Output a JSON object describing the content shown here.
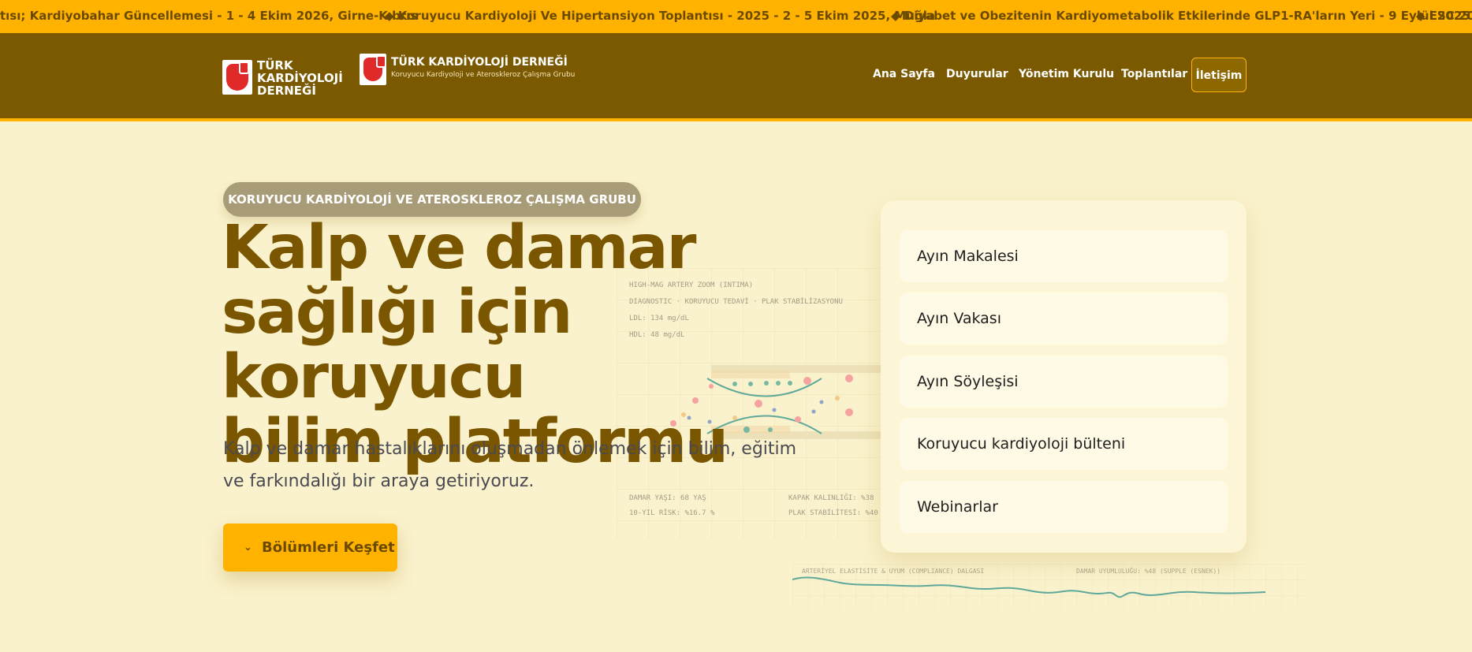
{
  "ticker": {
    "items": [
      "tısı; Kardiyobahar Güncellemesi - 1 - 4 Ekim 2026, Girne-Kıbrıs",
      "◆ Koruyucu Kardiyoloji Ve Hipertansiyon Toplantısı - 2025 - 2 - 5 Ekim 2025, Muğla",
      "◆ Diyabet ve Obezitenin Kardiyometabolik Etkilerinde GLP1-RA'ların Yeri - 9 Eylül 2025",
      "◆ ESC 2025"
    ]
  },
  "header": {
    "logo1": {
      "line1": "TÜRK",
      "line2": "KARDİYOLOJİ",
      "line3": "DERNEĞİ"
    },
    "logo2": {
      "title": "TÜRK KARDİYOLOJİ DERNEĞİ",
      "subtitle": "Koruyucu Kardiyoloji ve Ateroskleroz Çalışma Grubu"
    },
    "nav": [
      "Ana Sayfa",
      "Duyurular",
      "Yönetim Kurulu",
      "Toplantılar"
    ],
    "contact": "İletişim"
  },
  "hero": {
    "badge": "KORUYUCU KARDİYOLOJİ VE ATEROSKLEROZ ÇALIŞMA GRUBU",
    "title_lines": [
      "Kalp ve damar",
      "sağlığı için koruyucu",
      "bilim platformu"
    ],
    "subtitle_line1": "Kalp ve damar hastalıklarını oluşmadan önlemek için bilim, eğitim",
    "subtitle_line2": "ve farkındalığı bir araya getiriyoruz.",
    "cta": "Bölümleri Keşfet"
  },
  "graphic": {
    "lines": [
      "HIGH-MAG ARTERY ZOOM (INTIMA)",
      "DIAGNOSTIC · KORUYUCU TEDAVİ · PLAK STABİLİZASYONU",
      "LDL: 134 mg/dL",
      "HDL: 48 mg/dL"
    ],
    "stats_left": [
      "DAMAR YAŞI: 68 YAŞ",
      "10-YIL RİSK: %16.7 %"
    ],
    "stats_right": [
      "KAPAK KALINLIĞI: %38",
      "PLAK STABİLİTESİ: %40"
    ],
    "wave_left": "ARTERİYEL ELASTİSİTE & UYUM (COMPLIANCE) DALGASI",
    "wave_right": "DAMAR UYUMLULUĞU: %48 (SUPPLE (ESNEK))"
  },
  "card": {
    "items": [
      "Ayın Makalesi",
      "Ayın Vakası",
      "Ayın Söyleşisi",
      "Koruyucu kardiyoloji bülteni",
      "Webinarlar"
    ]
  }
}
